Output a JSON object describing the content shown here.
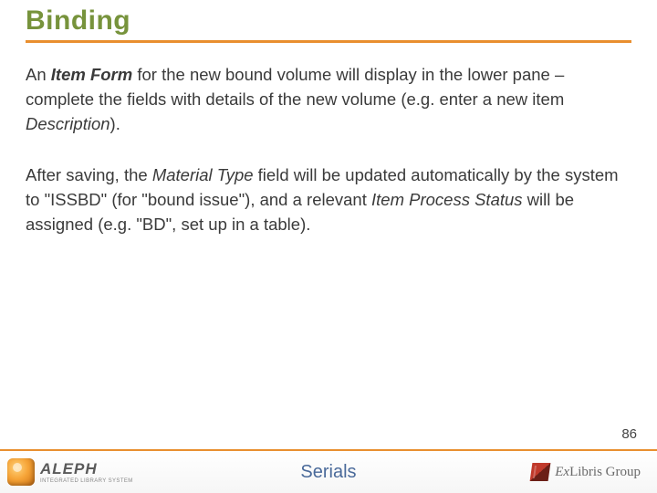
{
  "title": "Binding",
  "para1": {
    "t1": "An ",
    "bi1": "Item Form",
    "t2": " for the new bound volume will display in the lower pane – complete the fields with details of the new volume (e.g. enter a new item ",
    "it1": "Description",
    "t3": ")."
  },
  "para2": {
    "t1": "After saving, the ",
    "it1": "Material Type",
    "t2": " field will be updated automatically by the system to \"ISSBD\" (for \"bound issue\"), and a relevant ",
    "it2": "Item Process Status",
    "t3": " will be assigned (e.g. \"BD\", set up in a table)."
  },
  "pagenum": "86",
  "footer": {
    "center": "Serials",
    "aleph_main": "ALEPH",
    "aleph_sub": "INTEGRATED LIBRARY SYSTEM",
    "exlibris_prefix": "Ex",
    "exlibris_word": "Libris",
    "exlibris_suffix": " Group"
  }
}
